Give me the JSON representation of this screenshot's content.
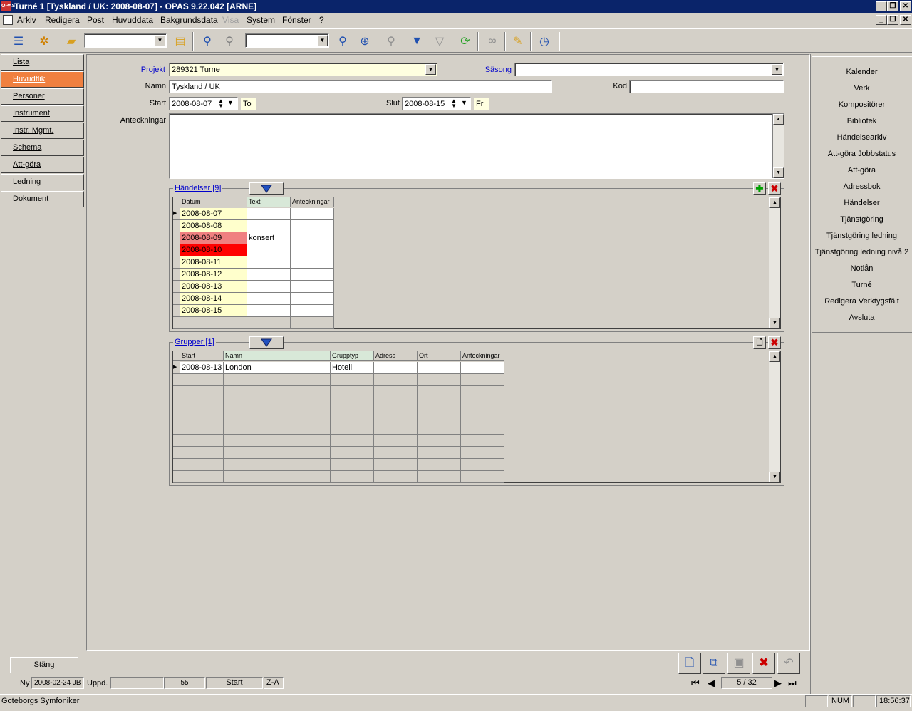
{
  "window": {
    "title": "Turné  1 [Tyskland  / UK: 2008-08-07] - OPAS 9.22.042  [ARNE]",
    "app_icon": "OPAS"
  },
  "menu": [
    "Arkiv",
    "Redigera",
    "Post",
    "Huvuddata",
    "Bakgrundsdata",
    "Visa",
    "System",
    "Fönster",
    "?"
  ],
  "nav": {
    "items": [
      "Lista",
      "Huvudflik",
      "Personer",
      "Instrument",
      "Instr. Mgmt.",
      "Schema",
      "Att-göra",
      "Ledning",
      "Dokument"
    ],
    "active": "Huvudflik"
  },
  "form": {
    "projekt_label": "Projekt",
    "projekt_value": "289321 Turne",
    "sasong_label": "Säsong",
    "sasong_value": "",
    "namn_label": "Namn",
    "namn_value": "Tyskland  / UK",
    "kod_label": "Kod",
    "kod_value": "",
    "start_label": "Start",
    "start_value": "2008-08-07",
    "start_day": "To",
    "slut_label": "Slut",
    "slut_value": "2008-08-15",
    "slut_day": "Fr",
    "anteckningar_label": "Anteckningar",
    "anteckningar_value": ""
  },
  "events": {
    "title": "Händelser  [9]",
    "columns": [
      "Datum",
      "Text",
      "Anteckningar"
    ],
    "rows": [
      {
        "datum": "2008-08-07",
        "text": "",
        "anteckningar": "",
        "color": "#ffffcc"
      },
      {
        "datum": "2008-08-08",
        "text": "",
        "anteckningar": "",
        "color": "#ffffcc"
      },
      {
        "datum": "2008-08-09",
        "text": "konsert",
        "anteckningar": "",
        "color": "#f08080"
      },
      {
        "datum": "2008-08-10",
        "text": "",
        "anteckningar": "",
        "color": "#ff0000"
      },
      {
        "datum": "2008-08-11",
        "text": "",
        "anteckningar": "",
        "color": "#ffffcc"
      },
      {
        "datum": "2008-08-12",
        "text": "",
        "anteckningar": "",
        "color": "#ffffcc"
      },
      {
        "datum": "2008-08-13",
        "text": "",
        "anteckningar": "",
        "color": "#ffffcc"
      },
      {
        "datum": "2008-08-14",
        "text": "",
        "anteckningar": "",
        "color": "#ffffcc"
      },
      {
        "datum": "2008-08-15",
        "text": "",
        "anteckningar": "",
        "color": "#ffffcc"
      }
    ]
  },
  "groups": {
    "title": "Grupper  [1]",
    "columns": [
      "Start",
      "Namn",
      "Grupptyp",
      "Adress",
      "Ort",
      "Anteckningar"
    ],
    "rows": [
      {
        "start": "2008-08-13",
        "namn": "London",
        "grupptyp": "Hotell",
        "adress": "",
        "ort": "",
        "anteckningar": ""
      }
    ]
  },
  "right_panel": [
    "Kalender",
    "Verk",
    "Kompositörer",
    "Bibliotek",
    "Händelsearkiv",
    "Att-göra Jobbstatus",
    "Att-göra",
    "Adressbok",
    "Händelser",
    "Tjänstgöring",
    "Tjänstgöring ledning",
    "Tjänstgöring ledning nivå 2",
    "Notlån",
    "Turné",
    "Redigera Verktygsfält",
    "Avsluta"
  ],
  "bottom": {
    "stang": "Stäng",
    "ny_label": "Ny",
    "ny_value": "2008-02-24 JB",
    "uppd_label": "Uppd.",
    "uppd_value": "",
    "count": "55",
    "sort_field": "Start",
    "sort_order": "Z-A",
    "record_pos": "5 / 32"
  },
  "status": {
    "org": "Goteborgs Symfoniker",
    "num": "NUM",
    "time": "18:56:37"
  },
  "colors": {
    "active_nav": "#f08040",
    "titlebar": "#0a246a",
    "yellow_field": "#ffffe0",
    "delete_red": "#cc0000",
    "add_green": "#00a000"
  }
}
